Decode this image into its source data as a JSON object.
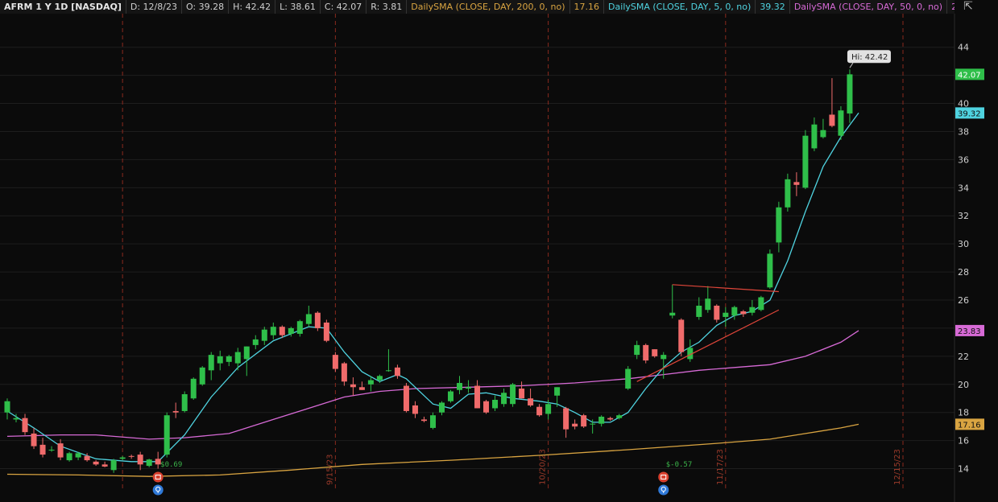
{
  "header": {
    "symbol": "AFRM 1 Y 1D [NASDAQ]",
    "date": "D: 12/8/23",
    "open": "O: 39.28",
    "high": "H: 42.42",
    "low": "L: 38.61",
    "close": "C: 42.07",
    "range": "R: 3.81",
    "sma200_label": "DailySMA (CLOSE, DAY, 200, 0, no)",
    "sma200_value": "17.16",
    "sma5_label": "DailySMA (CLOSE, DAY, 5, 0, no)",
    "sma5_value": "39.32",
    "sma50_label": "DailySMA (CLOSE, DAY, 50, 0, no)",
    "sma50_value": "23.83"
  },
  "colors": {
    "up": "#2fbf4a",
    "down": "#f06b6b",
    "sma5": "#4fd3e0",
    "sma50": "#d76ad6",
    "sma200": "#d9a441",
    "trendline": "#e0463a",
    "grid": "#1e1e1e",
    "date_marker": "#8a2a1e"
  },
  "icons": [
    "expand-icon",
    "earnings-icon",
    "dividend-icon"
  ],
  "chart_data": {
    "type": "candlestick",
    "ylim": [
      12.6,
      45.5
    ],
    "y_ticks": [
      14,
      16,
      18,
      20,
      22,
      24,
      26,
      28,
      30,
      32,
      34,
      36,
      38,
      40,
      42,
      44
    ],
    "price_tags": [
      {
        "label": "42.07",
        "value": 42.07,
        "color": "#2fbf4a"
      },
      {
        "label": "39.32",
        "value": 39.32,
        "color": "#4fd3e0"
      },
      {
        "label": "23.83",
        "value": 23.83,
        "color": "#d76ad6"
      },
      {
        "label": "17.16",
        "value": 17.16,
        "color": "#d9a441"
      }
    ],
    "high_annotation": "Hi: 42.42",
    "x_markers": [
      {
        "label": "",
        "index": 13
      },
      {
        "label": "9/15/23",
        "index": 37
      },
      {
        "label": "10/20/23",
        "index": 61
      },
      {
        "label": "11/17/23",
        "index": 81
      },
      {
        "label": "12/15/23",
        "index": 101
      }
    ],
    "candles": [
      {
        "o": 18.0,
        "h": 19.0,
        "l": 17.5,
        "c": 18.8
      },
      {
        "o": 17.5,
        "h": 17.9,
        "l": 17.3,
        "c": 17.6
      },
      {
        "o": 17.6,
        "h": 17.9,
        "l": 16.4,
        "c": 16.6
      },
      {
        "o": 16.5,
        "h": 16.9,
        "l": 15.4,
        "c": 15.6
      },
      {
        "o": 15.7,
        "h": 16.2,
        "l": 14.8,
        "c": 15.0
      },
      {
        "o": 15.3,
        "h": 15.6,
        "l": 15.2,
        "c": 15.35
      },
      {
        "o": 15.8,
        "h": 16.1,
        "l": 14.6,
        "c": 14.8
      },
      {
        "o": 14.6,
        "h": 15.2,
        "l": 14.5,
        "c": 15.1
      },
      {
        "o": 14.8,
        "h": 15.2,
        "l": 14.6,
        "c": 15.1
      },
      {
        "o": 14.9,
        "h": 15.1,
        "l": 14.5,
        "c": 14.6
      },
      {
        "o": 14.5,
        "h": 14.6,
        "l": 14.2,
        "c": 14.3
      },
      {
        "o": 14.3,
        "h": 14.5,
        "l": 14.1,
        "c": 14.15
      },
      {
        "o": 13.9,
        "h": 14.7,
        "l": 13.7,
        "c": 14.6
      },
      {
        "o": 14.7,
        "h": 14.9,
        "l": 14.6,
        "c": 14.8
      },
      {
        "o": 14.9,
        "h": 15.0,
        "l": 14.7,
        "c": 14.85
      },
      {
        "o": 15.0,
        "h": 15.2,
        "l": 13.9,
        "c": 14.3
      },
      {
        "o": 14.2,
        "h": 14.7,
        "l": 14.1,
        "c": 14.65
      },
      {
        "o": 14.7,
        "h": 15.2,
        "l": 14.0,
        "c": 14.3
      },
      {
        "o": 15.0,
        "h": 18.0,
        "l": 14.8,
        "c": 17.8
      },
      {
        "o": 18.1,
        "h": 18.7,
        "l": 17.6,
        "c": 18.0
      },
      {
        "o": 18.1,
        "h": 19.5,
        "l": 18.0,
        "c": 19.3
      },
      {
        "o": 19.0,
        "h": 20.5,
        "l": 18.9,
        "c": 20.4
      },
      {
        "o": 20.0,
        "h": 21.3,
        "l": 19.9,
        "c": 21.2
      },
      {
        "o": 21.0,
        "h": 22.3,
        "l": 20.3,
        "c": 22.1
      },
      {
        "o": 21.5,
        "h": 22.4,
        "l": 21.0,
        "c": 22.0
      },
      {
        "o": 21.6,
        "h": 22.1,
        "l": 21.3,
        "c": 22.0
      },
      {
        "o": 21.5,
        "h": 22.6,
        "l": 21.0,
        "c": 22.3
      },
      {
        "o": 21.8,
        "h": 22.7,
        "l": 20.6,
        "c": 22.7
      },
      {
        "o": 22.8,
        "h": 23.5,
        "l": 22.5,
        "c": 23.2
      },
      {
        "o": 23.1,
        "h": 24.1,
        "l": 22.8,
        "c": 23.9
      },
      {
        "o": 23.5,
        "h": 24.4,
        "l": 23.2,
        "c": 24.1
      },
      {
        "o": 24.1,
        "h": 24.2,
        "l": 23.3,
        "c": 23.5
      },
      {
        "o": 23.6,
        "h": 24.1,
        "l": 23.4,
        "c": 24.0
      },
      {
        "o": 23.6,
        "h": 24.6,
        "l": 23.4,
        "c": 24.5
      },
      {
        "o": 24.3,
        "h": 25.6,
        "l": 24.1,
        "c": 25.0
      },
      {
        "o": 25.1,
        "h": 25.2,
        "l": 23.8,
        "c": 24.0
      },
      {
        "o": 24.4,
        "h": 24.6,
        "l": 23.0,
        "c": 23.1
      },
      {
        "o": 22.1,
        "h": 22.3,
        "l": 20.9,
        "c": 21.1
      },
      {
        "o": 21.5,
        "h": 21.6,
        "l": 19.9,
        "c": 20.2
      },
      {
        "o": 20.0,
        "h": 20.5,
        "l": 19.2,
        "c": 19.8
      },
      {
        "o": 19.8,
        "h": 20.2,
        "l": 19.6,
        "c": 19.6
      },
      {
        "o": 20.0,
        "h": 20.6,
        "l": 19.5,
        "c": 20.3
      },
      {
        "o": 20.3,
        "h": 20.7,
        "l": 20.1,
        "c": 20.6
      },
      {
        "o": 21.0,
        "h": 22.5,
        "l": 20.9,
        "c": 21.0
      },
      {
        "o": 21.2,
        "h": 21.4,
        "l": 20.4,
        "c": 20.6
      },
      {
        "o": 19.9,
        "h": 20.1,
        "l": 18.0,
        "c": 18.1
      },
      {
        "o": 18.5,
        "h": 18.8,
        "l": 17.6,
        "c": 17.9
      },
      {
        "o": 17.5,
        "h": 17.7,
        "l": 17.3,
        "c": 17.4
      },
      {
        "o": 16.9,
        "h": 18.0,
        "l": 16.8,
        "c": 17.8
      },
      {
        "o": 18.0,
        "h": 18.8,
        "l": 17.8,
        "c": 18.7
      },
      {
        "o": 18.8,
        "h": 19.6,
        "l": 18.7,
        "c": 19.5
      },
      {
        "o": 19.6,
        "h": 20.6,
        "l": 19.3,
        "c": 20.1
      },
      {
        "o": 19.7,
        "h": 20.3,
        "l": 19.4,
        "c": 19.8
      },
      {
        "o": 19.9,
        "h": 20.3,
        "l": 18.3,
        "c": 18.3
      },
      {
        "o": 18.8,
        "h": 18.9,
        "l": 17.9,
        "c": 18.0
      },
      {
        "o": 18.3,
        "h": 19.2,
        "l": 18.1,
        "c": 18.9
      },
      {
        "o": 18.6,
        "h": 19.7,
        "l": 18.4,
        "c": 19.4
      },
      {
        "o": 18.6,
        "h": 20.1,
        "l": 18.4,
        "c": 20.0
      },
      {
        "o": 19.7,
        "h": 20.2,
        "l": 19.0,
        "c": 19.0
      },
      {
        "o": 19.0,
        "h": 19.7,
        "l": 18.4,
        "c": 18.5
      },
      {
        "o": 18.4,
        "h": 18.6,
        "l": 17.7,
        "c": 17.8
      },
      {
        "o": 17.9,
        "h": 18.9,
        "l": 17.5,
        "c": 18.6
      },
      {
        "o": 19.2,
        "h": 19.8,
        "l": 18.4,
        "c": 19.8
      },
      {
        "o": 18.3,
        "h": 18.4,
        "l": 16.2,
        "c": 16.8
      },
      {
        "o": 17.2,
        "h": 17.5,
        "l": 16.8,
        "c": 17.0
      },
      {
        "o": 17.8,
        "h": 17.9,
        "l": 16.9,
        "c": 17.0
      },
      {
        "o": 17.2,
        "h": 17.5,
        "l": 16.5,
        "c": 17.2
      },
      {
        "o": 17.2,
        "h": 17.8,
        "l": 17.0,
        "c": 17.7
      },
      {
        "o": 17.6,
        "h": 17.7,
        "l": 17.4,
        "c": 17.5
      },
      {
        "o": 17.6,
        "h": 17.9,
        "l": 17.5,
        "c": 17.8
      },
      {
        "o": 19.7,
        "h": 21.3,
        "l": 19.6,
        "c": 21.1
      },
      {
        "o": 22.1,
        "h": 23.1,
        "l": 21.8,
        "c": 22.8
      },
      {
        "o": 22.8,
        "h": 22.9,
        "l": 21.5,
        "c": 21.7
      },
      {
        "o": 22.5,
        "h": 22.5,
        "l": 21.9,
        "c": 22.0
      },
      {
        "o": 21.8,
        "h": 22.3,
        "l": 20.4,
        "c": 22.1
      },
      {
        "o": 24.9,
        "h": 27.1,
        "l": 24.7,
        "c": 25.1
      },
      {
        "o": 24.6,
        "h": 24.7,
        "l": 22.0,
        "c": 22.3
      },
      {
        "o": 21.8,
        "h": 23.2,
        "l": 21.6,
        "c": 22.6
      },
      {
        "o": 24.8,
        "h": 26.2,
        "l": 24.6,
        "c": 25.6
      },
      {
        "o": 25.3,
        "h": 27.0,
        "l": 25.1,
        "c": 26.1
      },
      {
        "o": 25.6,
        "h": 25.7,
        "l": 24.4,
        "c": 24.6
      },
      {
        "o": 24.8,
        "h": 25.5,
        "l": 24.1,
        "c": 25.1
      },
      {
        "o": 24.9,
        "h": 25.6,
        "l": 24.6,
        "c": 25.5
      },
      {
        "o": 25.2,
        "h": 25.3,
        "l": 24.8,
        "c": 25.0
      },
      {
        "o": 25.1,
        "h": 26.0,
        "l": 24.9,
        "c": 25.5
      },
      {
        "o": 25.3,
        "h": 26.3,
        "l": 25.2,
        "c": 26.2
      },
      {
        "o": 26.9,
        "h": 29.6,
        "l": 26.8,
        "c": 29.3
      },
      {
        "o": 30.1,
        "h": 33.0,
        "l": 29.4,
        "c": 32.6
      },
      {
        "o": 32.6,
        "h": 35.0,
        "l": 32.3,
        "c": 34.6
      },
      {
        "o": 34.4,
        "h": 35.1,
        "l": 33.4,
        "c": 34.2
      },
      {
        "o": 34.0,
        "h": 38.1,
        "l": 33.9,
        "c": 37.7
      },
      {
        "o": 36.8,
        "h": 39.0,
        "l": 36.6,
        "c": 38.5
      },
      {
        "o": 37.6,
        "h": 38.9,
        "l": 37.5,
        "c": 38.1
      },
      {
        "o": 39.2,
        "h": 41.8,
        "l": 38.3,
        "c": 38.4
      },
      {
        "o": 37.7,
        "h": 39.8,
        "l": 37.4,
        "c": 39.5
      },
      {
        "o": 39.28,
        "h": 42.42,
        "l": 38.61,
        "c": 42.07
      }
    ],
    "sma5": [
      [
        0,
        18.1
      ],
      [
        3,
        16.9
      ],
      [
        6,
        15.6
      ],
      [
        10,
        14.7
      ],
      [
        14,
        14.5
      ],
      [
        17,
        14.5
      ],
      [
        20,
        16.4
      ],
      [
        23,
        19.1
      ],
      [
        26,
        21.2
      ],
      [
        30,
        23.1
      ],
      [
        34,
        24.1
      ],
      [
        36,
        24.0
      ],
      [
        38,
        22.3
      ],
      [
        40,
        20.9
      ],
      [
        42,
        20.2
      ],
      [
        44,
        20.7
      ],
      [
        45,
        20.4
      ],
      [
        48,
        18.6
      ],
      [
        50,
        18.3
      ],
      [
        52,
        19.3
      ],
      [
        54,
        19.4
      ],
      [
        57,
        19.0
      ],
      [
        60,
        18.8
      ],
      [
        62,
        18.6
      ],
      [
        64,
        18.0
      ],
      [
        66,
        17.3
      ],
      [
        68,
        17.3
      ],
      [
        70,
        18.0
      ],
      [
        72,
        19.7
      ],
      [
        74,
        21.2
      ],
      [
        76,
        22.3
      ],
      [
        78,
        23.0
      ],
      [
        80,
        24.2
      ],
      [
        82,
        24.9
      ],
      [
        84,
        25.2
      ],
      [
        86,
        26.0
      ],
      [
        88,
        28.8
      ],
      [
        90,
        32.3
      ],
      [
        92,
        35.5
      ],
      [
        94,
        37.6
      ],
      [
        96,
        39.32
      ]
    ],
    "sma50": [
      [
        0,
        16.3
      ],
      [
        6,
        16.4
      ],
      [
        10,
        16.4
      ],
      [
        16,
        16.1
      ],
      [
        20,
        16.2
      ],
      [
        25,
        16.5
      ],
      [
        30,
        17.5
      ],
      [
        34,
        18.3
      ],
      [
        38,
        19.1
      ],
      [
        42,
        19.5
      ],
      [
        46,
        19.7
      ],
      [
        52,
        19.8
      ],
      [
        58,
        19.9
      ],
      [
        64,
        20.1
      ],
      [
        70,
        20.4
      ],
      [
        74,
        20.7
      ],
      [
        78,
        21.0
      ],
      [
        82,
        21.2
      ],
      [
        86,
        21.4
      ],
      [
        90,
        22.0
      ],
      [
        94,
        23.0
      ],
      [
        96,
        23.83
      ]
    ],
    "sma200": [
      [
        0,
        13.6
      ],
      [
        8,
        13.55
      ],
      [
        16,
        13.45
      ],
      [
        24,
        13.55
      ],
      [
        32,
        13.9
      ],
      [
        40,
        14.3
      ],
      [
        50,
        14.6
      ],
      [
        60,
        14.95
      ],
      [
        70,
        15.35
      ],
      [
        80,
        15.8
      ],
      [
        86,
        16.1
      ],
      [
        90,
        16.5
      ],
      [
        94,
        16.9
      ],
      [
        96,
        17.16
      ]
    ],
    "trendlines": [
      {
        "from": [
          75,
          27.1
        ],
        "to": [
          87,
          26.6
        ]
      },
      {
        "from": [
          71,
          20.2
        ],
        "to": [
          87,
          25.3
        ]
      }
    ],
    "events": [
      {
        "index": 17,
        "earnings_label": "$0.69"
      },
      {
        "index": 74,
        "earnings_label": "$-0.57"
      }
    ]
  }
}
